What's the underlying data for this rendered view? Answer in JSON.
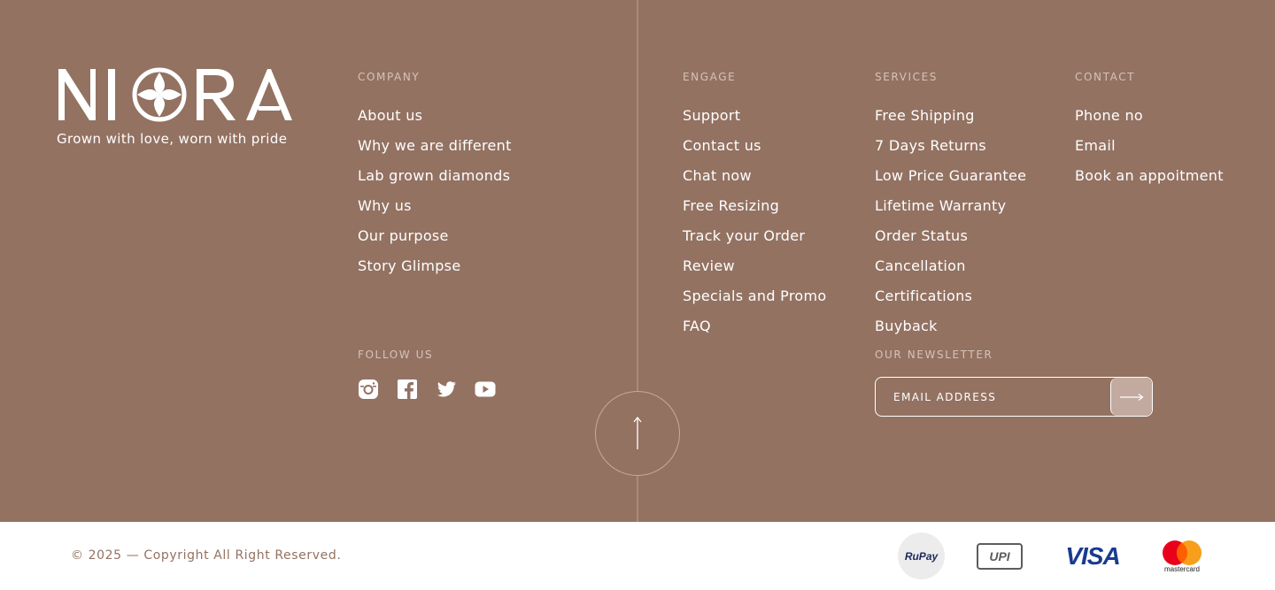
{
  "brand": {
    "logo_text": "NIORA",
    "tagline": "Grown with love, worn with pride"
  },
  "columns": {
    "company": {
      "heading": "COMPANY",
      "items": [
        "About us",
        "Why we are different",
        "Lab grown diamonds",
        "Why us",
        "Our purpose",
        "Story Glimpse"
      ]
    },
    "engage": {
      "heading": "ENGAGE",
      "items": [
        "Support",
        "Contact us",
        "Chat now",
        "Free Resizing",
        "Track your Order",
        "Review",
        "Specials and Promo",
        "FAQ"
      ]
    },
    "services": {
      "heading": "SERVICES",
      "items": [
        "Free Shipping",
        "7 Days Returns",
        "Low Price Guarantee",
        "Lifetime Warranty",
        "Order Status",
        "Cancellation",
        "Certifications",
        "Buyback"
      ]
    },
    "contact": {
      "heading": "CONTACT",
      "items": [
        "Phone no",
        "Email",
        "Book an appoitment"
      ]
    }
  },
  "follow": {
    "heading": "FOLLOW US",
    "icons": [
      "instagram-icon",
      "facebook-icon",
      "twitter-icon",
      "youtube-icon"
    ]
  },
  "newsletter": {
    "heading": "OUR NEWSLETTER",
    "placeholder": "EMAIL ADDRESS",
    "submit_icon": "arrow-right-icon"
  },
  "back_to_top_icon": "arrow-up-icon",
  "bottom": {
    "copyright": "© 2025 — Copyright All Right Reserved.",
    "payments": {
      "rupay": "RuPay",
      "upi": "UPI",
      "visa": "VISA",
      "mastercard": "mastercard"
    }
  },
  "colors": {
    "footer_bg": "#937262",
    "heading_muted": "#d6c2b7",
    "bottom_bg": "#ffffff",
    "copyright_text": "#937262"
  }
}
